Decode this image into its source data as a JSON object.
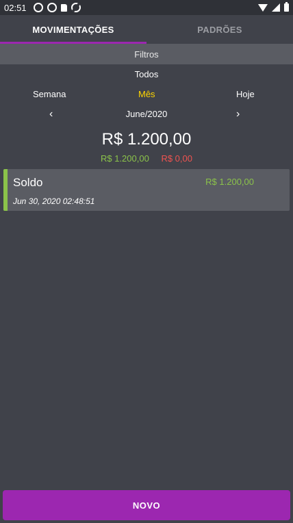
{
  "status_bar": {
    "time": "02:51"
  },
  "tabs": [
    {
      "label": "MOVIMENTAÇÕES",
      "active": true
    },
    {
      "label": "PADRÕES",
      "active": false
    }
  ],
  "filters": {
    "header": "Filtros",
    "all": "Todos",
    "periods": {
      "week": "Semana",
      "month": "Mês",
      "today": "Hoje"
    },
    "selected_period": "Mês",
    "prev_icon": "chevron-left-icon",
    "next_icon": "chevron-right-icon",
    "current_month": "June/2020"
  },
  "summary": {
    "total": "R$ 1.200,00",
    "income": "R$ 1.200,00",
    "expense": "R$ 0,00"
  },
  "transactions": [
    {
      "title": "Soldo",
      "amount": "R$ 1.200,00",
      "date": "Jun 30, 2020 02:48:51"
    }
  ],
  "actions": {
    "new_label": "NOVO"
  },
  "colors": {
    "accent": "#9c27b0",
    "positive": "#8bc34a",
    "negative": "#ef5350",
    "selected": "#ffd600"
  }
}
